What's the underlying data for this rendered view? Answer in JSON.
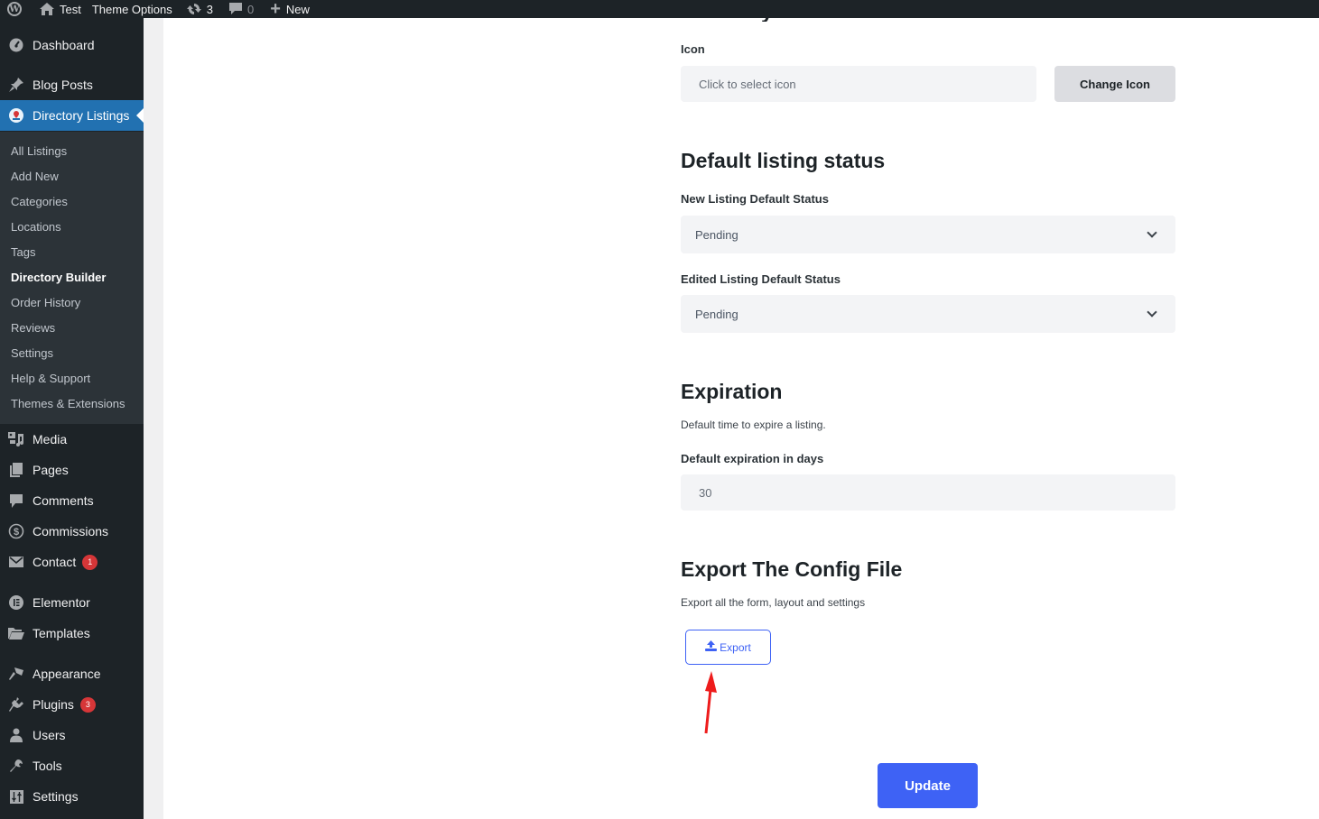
{
  "adminbar": {
    "site_name": "Test",
    "theme_options": "Theme Options",
    "updates_count": "3",
    "comments_count": "0",
    "new_label": "New"
  },
  "sidebar": {
    "top_items": [
      {
        "label": "Dashboard",
        "icon": "dashboard-icon"
      },
      {
        "label": "Blog Posts",
        "icon": "pin-icon"
      },
      {
        "label": "Directory Listings",
        "icon": "map-marker-icon",
        "current": true
      }
    ],
    "submenu": [
      {
        "label": "All Listings"
      },
      {
        "label": "Add New"
      },
      {
        "label": "Categories"
      },
      {
        "label": "Locations"
      },
      {
        "label": "Tags"
      },
      {
        "label": "Directory Builder",
        "active": true
      },
      {
        "label": "Order History"
      },
      {
        "label": "Reviews"
      },
      {
        "label": "Settings"
      },
      {
        "label": "Help & Support"
      },
      {
        "label": "Themes & Extensions"
      }
    ],
    "items": [
      {
        "label": "Media",
        "icon": "media-icon"
      },
      {
        "label": "Pages",
        "icon": "pages-icon"
      },
      {
        "label": "Comments",
        "icon": "comment-icon"
      },
      {
        "label": "Commissions",
        "icon": "dollar-icon"
      },
      {
        "label": "Contact",
        "icon": "mail-icon",
        "badge": "1"
      },
      {
        "label": "Elementor",
        "icon": "elementor-icon"
      },
      {
        "label": "Templates",
        "icon": "folder-icon"
      },
      {
        "label": "Appearance",
        "icon": "brush-icon"
      },
      {
        "label": "Plugins",
        "icon": "plugin-icon",
        "badge": "3"
      },
      {
        "label": "Users",
        "icon": "user-icon"
      },
      {
        "label": "Tools",
        "icon": "wrench-icon"
      },
      {
        "label": "Settings",
        "icon": "sliders-icon"
      }
    ]
  },
  "main": {
    "icon_field": {
      "label": "Icon",
      "placeholder": "Click to select icon",
      "button": "Change Icon"
    },
    "default_status": {
      "title": "Default listing status",
      "new_label": "New Listing Default Status",
      "new_value": "Pending",
      "edited_label": "Edited Listing Default Status",
      "edited_value": "Pending"
    },
    "expiration": {
      "title": "Expiration",
      "description": "Default time to expire a listing.",
      "days_label": "Default expiration in days",
      "days_value": "30"
    },
    "export": {
      "title": "Export The Config File",
      "description": "Export all the form, layout and settings",
      "button": "Export"
    },
    "update_button": "Update"
  },
  "colors": {
    "accent": "#3e62f5",
    "wp_blue": "#2271b1",
    "badge_red": "#d63638",
    "annotation_arrow": "#ee1c1c"
  }
}
